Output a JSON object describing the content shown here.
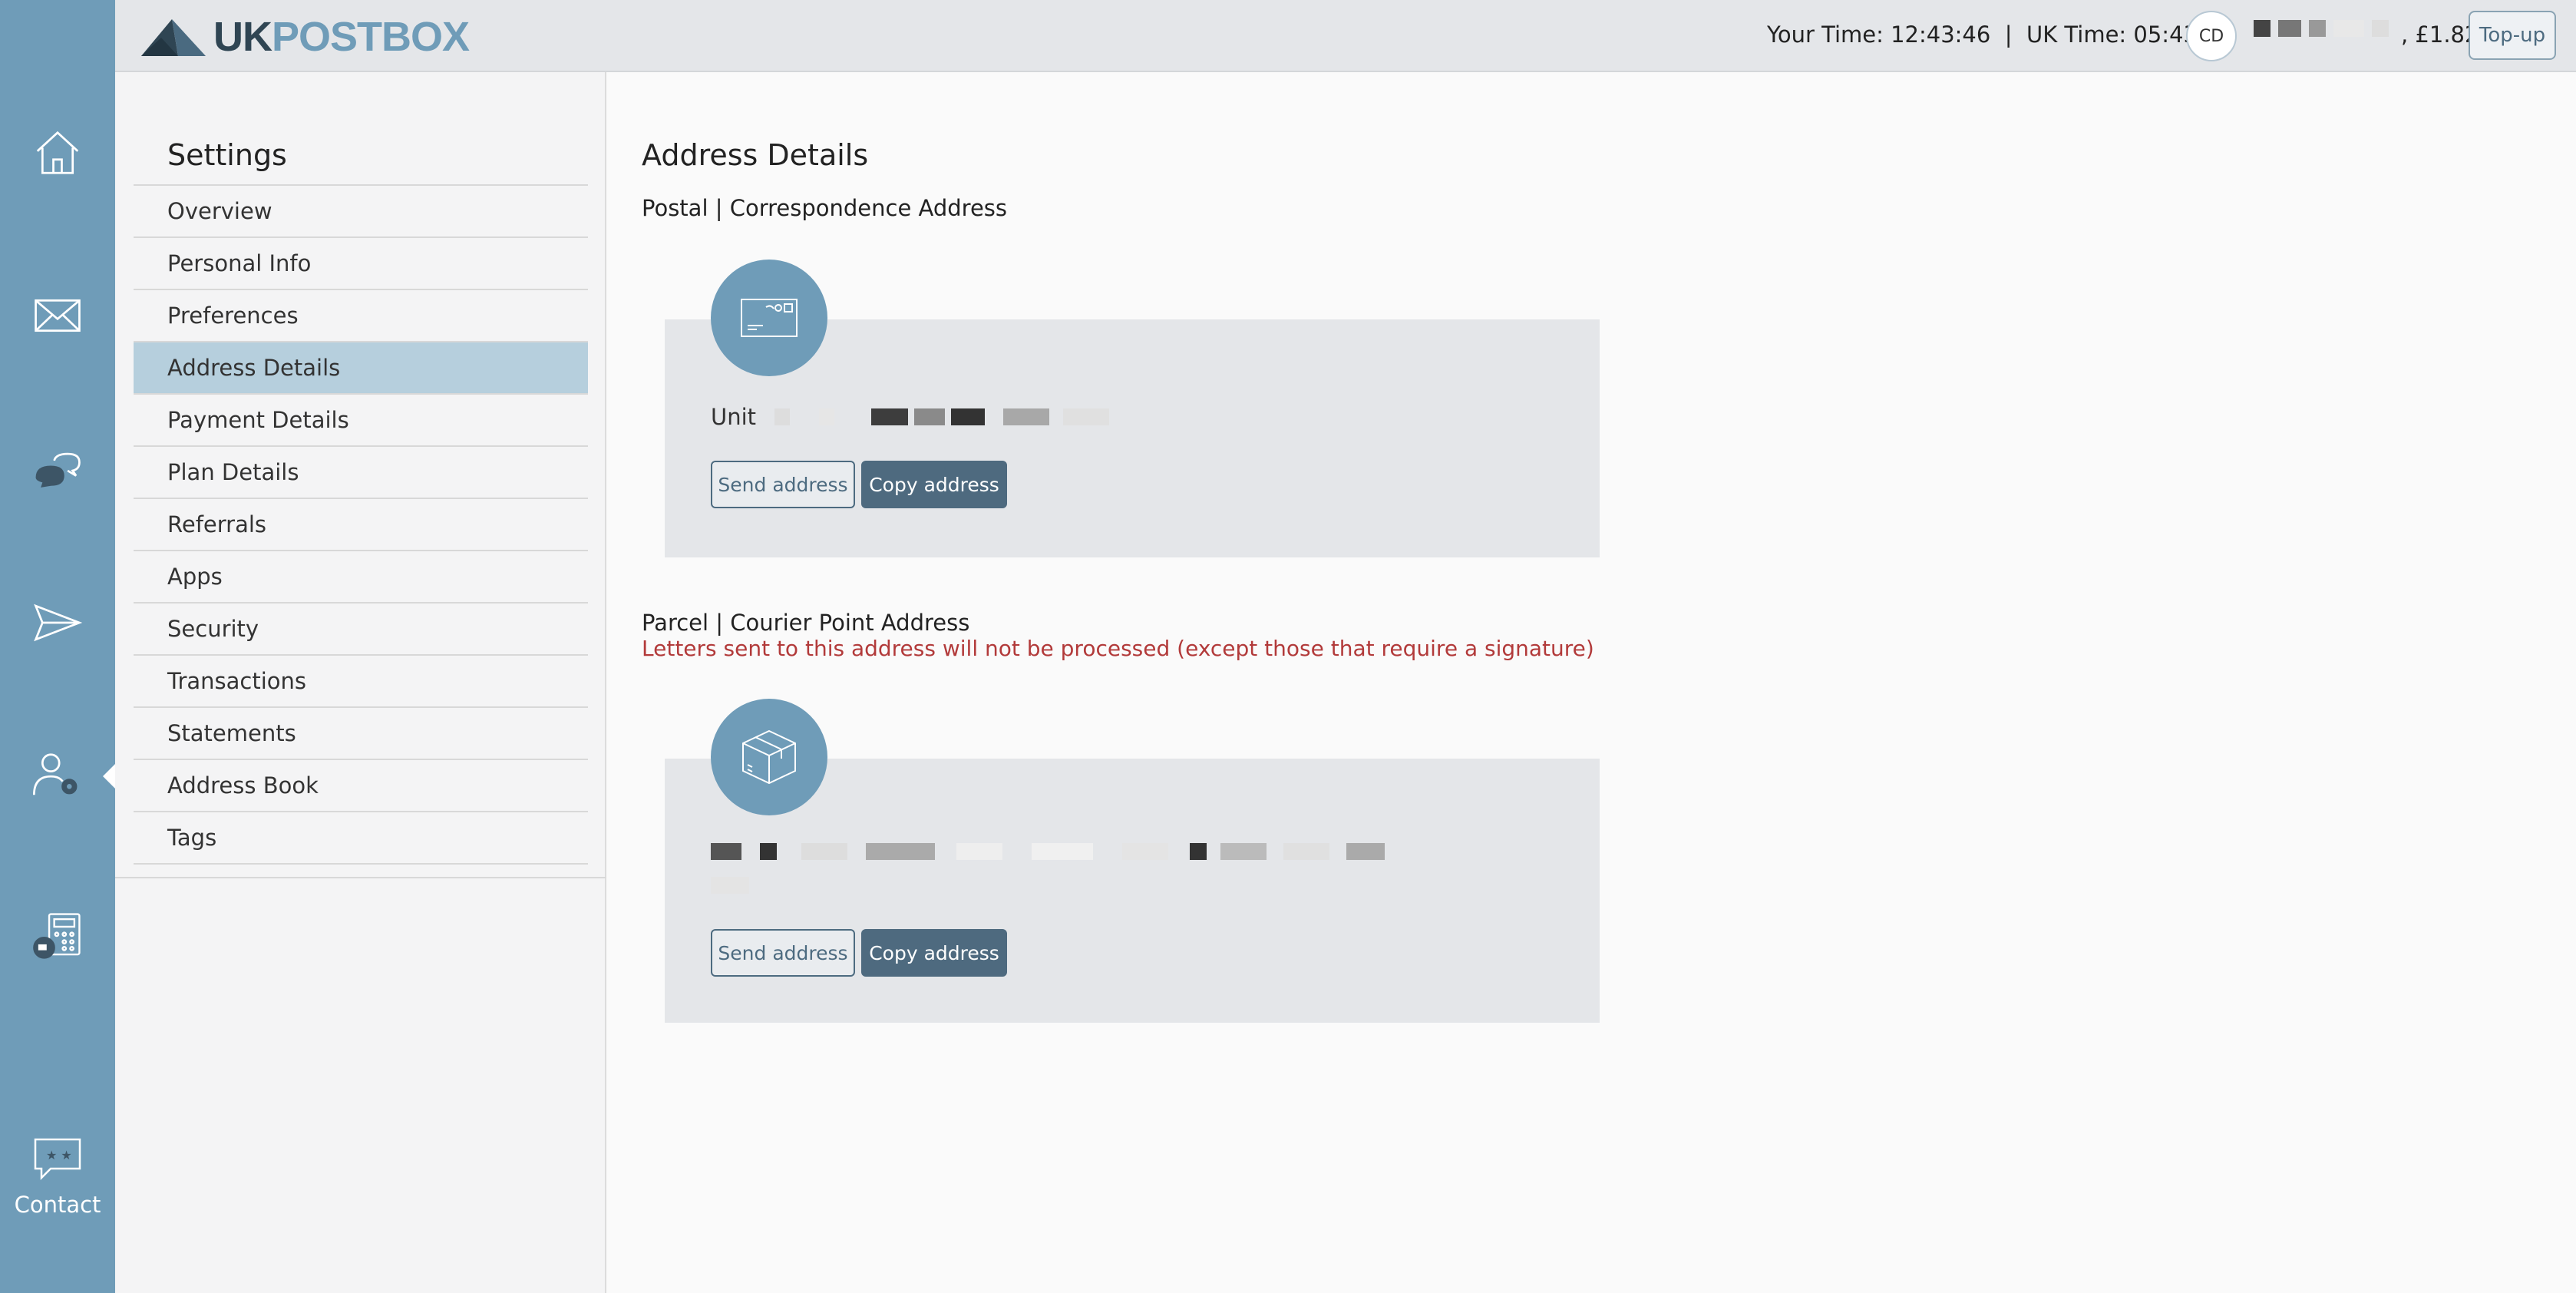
{
  "rail": {
    "items": [
      {
        "icon": "home-icon"
      },
      {
        "icon": "mail-icon"
      },
      {
        "icon": "chat-icon"
      },
      {
        "icon": "send-icon"
      },
      {
        "icon": "user-settings-icon"
      },
      {
        "icon": "shipping-calculator-icon"
      }
    ],
    "contact_label": "Contact"
  },
  "header": {
    "logo_uk": "UK",
    "logo_postbox": "POSTBOX",
    "times": "Your Time: 12:43:46  |  UK Time: 05:43:46",
    "avatar_initials": "CD",
    "balance": ", £1.82",
    "topup_label": "Top-up"
  },
  "settings": {
    "title": "Settings",
    "items": [
      {
        "label": "Overview"
      },
      {
        "label": "Personal Info"
      },
      {
        "label": "Preferences"
      },
      {
        "label": "Address Details",
        "active": true
      },
      {
        "label": "Payment Details"
      },
      {
        "label": "Plan Details"
      },
      {
        "label": "Referrals"
      },
      {
        "label": "Apps"
      },
      {
        "label": "Security"
      },
      {
        "label": "Transactions"
      },
      {
        "label": "Statements"
      },
      {
        "label": "Address Book"
      },
      {
        "label": "Tags"
      }
    ]
  },
  "main": {
    "heading": "Address Details",
    "postal": {
      "title": "Postal | Correspondence Address",
      "address_prefix": "Unit",
      "send_label": "Send address",
      "copy_label": "Copy address"
    },
    "parcel": {
      "title": "Parcel | Courier Point Address",
      "warning": "Letters sent to this address will not be processed (except those that require a signature)",
      "send_label": "Send address",
      "copy_label": "Copy address"
    }
  },
  "colors": {
    "rail": "#6f9cb8",
    "accent_dark": "#4e6a7f",
    "active_item": "#b6cfdd",
    "warning": "#b23a3a"
  }
}
